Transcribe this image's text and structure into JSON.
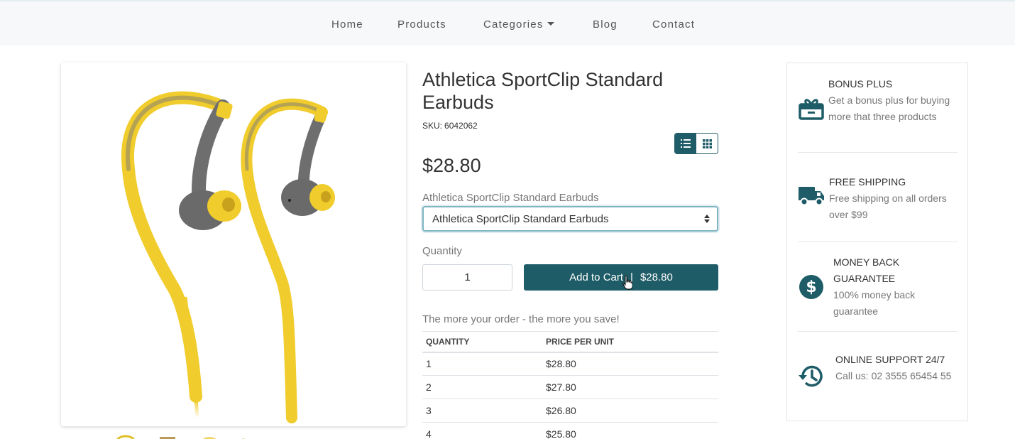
{
  "nav": {
    "items": [
      "Home",
      "Products",
      "Categories",
      "Blog",
      "Contact"
    ]
  },
  "product": {
    "title": "Athletica SportClip Standard Earbuds",
    "sku_label": "SKU:",
    "sku": "6042062",
    "price": "$28.80",
    "variant_label": "Athletica SportClip Standard Earbuds",
    "variant_selected": "Athletica SportClip Standard Earbuds",
    "quantity_label": "Quantity",
    "quantity": "1",
    "add_to_cart_label": "Add to Cart",
    "add_to_cart_sep": "|",
    "add_to_cart_price": "$28.80"
  },
  "tiers": {
    "title": "The more your order - the more you save!",
    "headers": [
      "QUANTITY",
      "PRICE PER UNIT"
    ],
    "rows": [
      [
        "1",
        "$28.80"
      ],
      [
        "2",
        "$27.80"
      ],
      [
        "3",
        "$26.80"
      ],
      [
        "4",
        "$25.80"
      ]
    ]
  },
  "features": [
    {
      "icon": "gift-icon",
      "title": "BONUS PLUS",
      "desc": "Get a bonus plus for buying more that three products"
    },
    {
      "icon": "truck-icon",
      "title": "FREE SHIPPING",
      "desc": "Free shipping on all orders over $99"
    },
    {
      "icon": "dollar-circle-icon",
      "title": "MONEY BACK GUARANTEE",
      "desc": "100% money back guarantee"
    },
    {
      "icon": "history-icon",
      "title": "ONLINE SUPPORT 24/7",
      "desc": "Call us: 02 3555 65454 55"
    }
  ],
  "colors": {
    "primary": "#1e5c67",
    "earbud_yellow": "#f0cc2c",
    "earbud_gray": "#6e6e6e"
  }
}
